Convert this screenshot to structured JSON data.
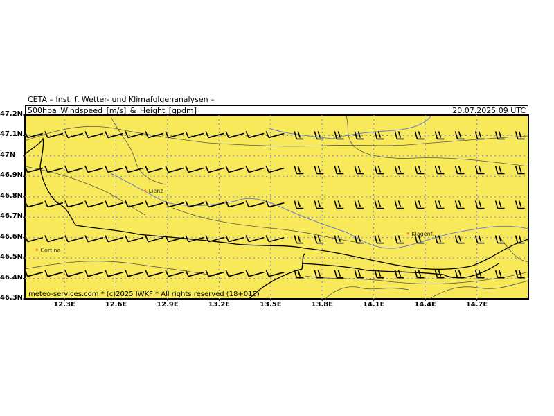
{
  "header": {
    "institute": "CETA – Inst. f. Wetter- und Klimafolgenanalysen –",
    "product": "500hpa_Windspeed_[m/s]_&_Height_[gpdm]",
    "datetime": "20.07.2025 09 UTC"
  },
  "footer": {
    "credit": "meteo-services.com * (c)2025 IWKF * All rights reserved (18+015)"
  },
  "axes": {
    "lat_labels": [
      "47.2N",
      "47.1N",
      "47N",
      "46.9N",
      "46.8N",
      "46.7N",
      "46.6N",
      "46.5N",
      "46.4N",
      "46.3N"
    ],
    "lat_values": [
      47.2,
      47.1,
      47.0,
      46.9,
      46.8,
      46.7,
      46.6,
      46.5,
      46.4,
      46.3
    ],
    "lon_labels": [
      "12.3E",
      "12.6E",
      "12.9E",
      "13.2E",
      "13.5E",
      "13.8E",
      "14.1E",
      "14.4E",
      "14.7E"
    ],
    "lon_values": [
      12.3,
      12.6,
      12.9,
      13.2,
      13.5,
      13.8,
      14.1,
      14.4,
      14.7
    ],
    "lon_range": [
      12.07,
      15.0
    ],
    "lat_range": [
      46.3,
      47.2
    ]
  },
  "cities": [
    {
      "name": "Lienz",
      "lon": 12.77,
      "lat": 46.83
    },
    {
      "name": "Klagenf.",
      "lon": 14.3,
      "lat": 46.62
    },
    {
      "name": "Cortina",
      "lon": 12.14,
      "lat": 46.54
    }
  ],
  "style": {
    "field_color": "#f7e959",
    "grid_color": "#8a8ad6",
    "river_color": "#6b7fd0"
  },
  "wind_barbs": {
    "description": "wind barbs on regular grid",
    "lat_rows": [
      47.1,
      46.93,
      46.76,
      46.59,
      46.42
    ],
    "lon_start": 12.07,
    "lon_step": 0.117
  }
}
